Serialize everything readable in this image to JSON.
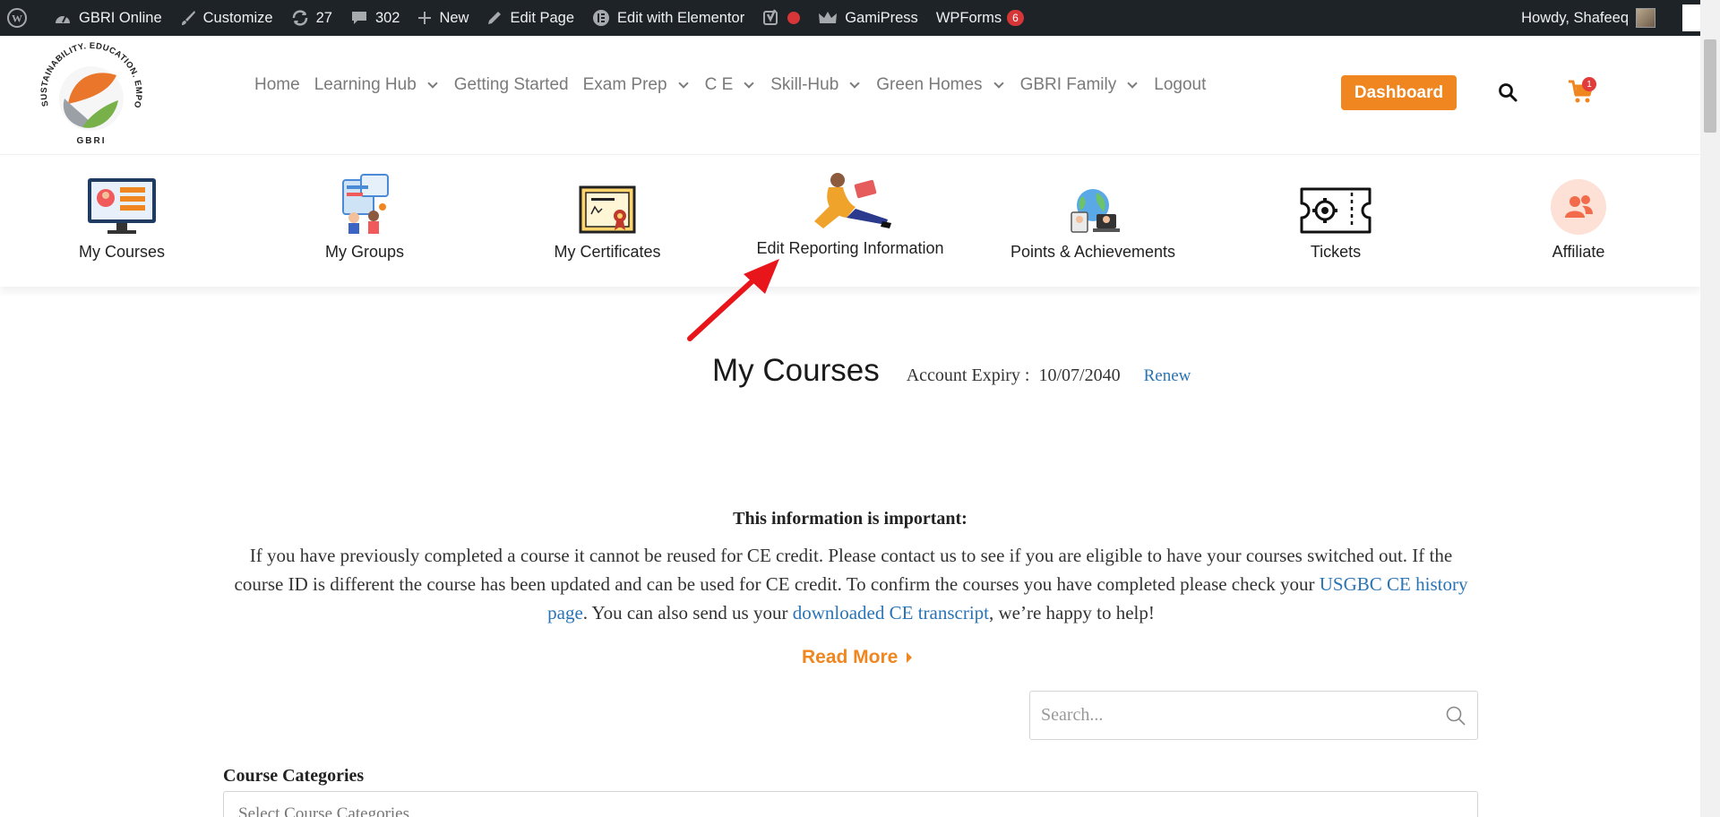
{
  "admin_bar": {
    "site_name": "GBRI Online",
    "customize": "Customize",
    "updates_count": "27",
    "comments_count": "302",
    "new": "New",
    "edit_page": "Edit Page",
    "edit_elementor": "Edit with Elementor",
    "gamipress": "GamiPress",
    "wpforms": "WPForms",
    "wpforms_badge": "6",
    "howdy": "Howdy, Shafeeq"
  },
  "logo": {
    "arc_text": "SUSTAINABILITY. EDUCATION. EMPOWERMENT",
    "short": "GBRI"
  },
  "nav": [
    {
      "label": "Home",
      "dropdown": false
    },
    {
      "label": "Learning Hub",
      "dropdown": true
    },
    {
      "label": "Getting Started",
      "dropdown": false
    },
    {
      "label": "Exam Prep",
      "dropdown": true
    },
    {
      "label": "C E",
      "dropdown": true
    },
    {
      "label": "Skill-Hub",
      "dropdown": true
    },
    {
      "label": "Green Homes",
      "dropdown": true
    },
    {
      "label": "GBRI Family",
      "dropdown": true
    },
    {
      "label": "Logout",
      "dropdown": false
    }
  ],
  "header": {
    "dashboard_label": "Dashboard",
    "cart_count": "1"
  },
  "tiles": [
    {
      "label": "My Courses",
      "icon": "computer-icon"
    },
    {
      "label": "My Groups",
      "icon": "group-icon"
    },
    {
      "label": "My Certificates",
      "icon": "certificate-icon"
    },
    {
      "label": "Edit Reporting Information",
      "icon": "person-reading-icon"
    },
    {
      "label": "Points & Achievements",
      "icon": "globe-people-icon"
    },
    {
      "label": "Tickets",
      "icon": "ticket-gear-icon"
    },
    {
      "label": "Affiliate",
      "icon": "users-icon"
    }
  ],
  "main": {
    "title": "My Courses",
    "expiry_label": "Account Expiry :",
    "expiry_date": "10/07/2040",
    "renew": "Renew",
    "info_heading": "This information is important:",
    "info_p1": "If you have previously completed a course it cannot be reused for CE credit. Please contact us to see if you are eligible to have your courses switched out. If the course ID is different the course has been updated and can be used for CE credit. To confirm the courses you have completed please check your ",
    "info_link1": "USGBC CE history page",
    "info_p2": ". You can also send us your ",
    "info_link2": "downloaded CE transcript",
    "info_p3": ", we’re happy to help!",
    "read_more": "Read More",
    "search_placeholder": "Search...",
    "categories_label": "Course Categories",
    "categories_select": "Select Course Categories"
  },
  "colors": {
    "accent_orange": "#f0861f",
    "link_blue": "#2a74b5",
    "admin_bar": "#1d2327",
    "annotation_arrow": "#e8161b"
  }
}
